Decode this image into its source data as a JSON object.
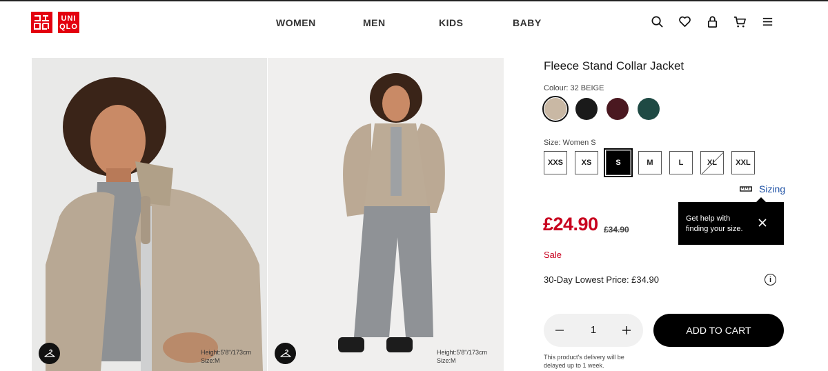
{
  "brand": {
    "logo_left": "ユニクロ",
    "logo_right": "UNI QLO",
    "color": "#e3000f"
  },
  "nav": {
    "items": [
      "WOMEN",
      "MEN",
      "KIDS",
      "BABY"
    ]
  },
  "header_icons": [
    "search-icon",
    "heart-icon",
    "account-icon",
    "cart-icon",
    "menu-icon"
  ],
  "gallery": {
    "images": [
      {
        "caption_height": "Height:5'8\"/173cm",
        "caption_size": "Size:M"
      },
      {
        "caption_height": "Height:5'8\"/173cm",
        "caption_size": "Size:M"
      }
    ]
  },
  "product": {
    "title": "Fleece Stand Collar Jacket",
    "colour_label": "Colour: 32 BEIGE",
    "colours": [
      {
        "name": "beige",
        "hex": "#c9b8a4",
        "selected": true
      },
      {
        "name": "black",
        "hex": "#1a1a1a",
        "selected": false
      },
      {
        "name": "wine",
        "hex": "#4a1820",
        "selected": false
      },
      {
        "name": "green",
        "hex": "#1f4a44",
        "selected": false
      }
    ],
    "size_label": "Size: Women S",
    "sizes": [
      "XXS",
      "XS",
      "S",
      "M",
      "L",
      "XL",
      "XXL"
    ],
    "selected_size": "S",
    "unavailable_size": "XL",
    "sizing_label": "Sizing",
    "tooltip_line1": "Get help with",
    "tooltip_line2": "finding your size.",
    "price": "£24.90",
    "old_price": "£34.90",
    "sale_label": "Sale",
    "lowest_price": "30-Day Lowest Price: £34.90",
    "info_glyph": "i",
    "quantity": "1",
    "add_to_cart": "ADD TO CART",
    "delivery_note": "This product's delivery will be delayed up to 1 week."
  }
}
